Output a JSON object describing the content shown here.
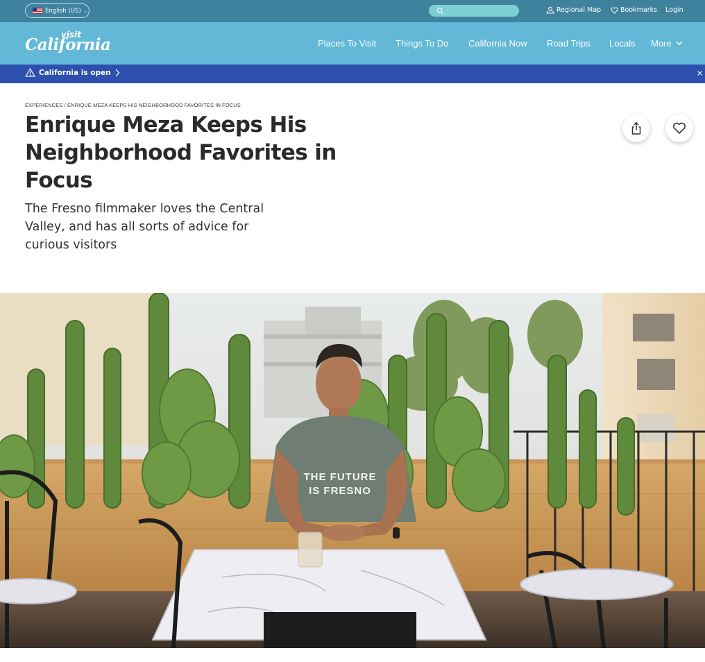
{
  "utility_bar": {
    "language": "English (US)",
    "search_placeholder": "",
    "links": {
      "regional_map": "Regional Map",
      "bookmarks": "Bookmarks",
      "login": "Login"
    }
  },
  "nav": {
    "logo_top": "visit",
    "logo_main": "California",
    "items": [
      "Places To Visit",
      "Things To Do",
      "California Now",
      "Road Trips",
      "Locals",
      "More"
    ]
  },
  "alert": {
    "text": "California is open"
  },
  "article": {
    "breadcrumb": {
      "section": "Experiences",
      "separator": "/",
      "current": "Enrique Meza Keeps His Neighborhood Favorites in Focus"
    },
    "title": "Enrique Meza Keeps His Neighborhood Favorites in Focus",
    "subtitle": "The Fresno filmmaker loves the Central Valley, and has all sorts of advice for curious visitors"
  },
  "hero": {
    "shirt_text_line1": "THE FUTURE",
    "shirt_text_line2": "IS FRESNO"
  },
  "colors": {
    "utility_bar": "#3f829e",
    "main_nav": "#62b8d6",
    "alert_bar": "#2d4fae",
    "search_pill": "#7dcfd5"
  },
  "icons": {
    "search": "search-icon",
    "map": "map-icon",
    "bookmark": "heart-icon",
    "warning": "warning-icon",
    "share": "share-icon",
    "favorite": "heart-icon",
    "close": "close-icon"
  }
}
